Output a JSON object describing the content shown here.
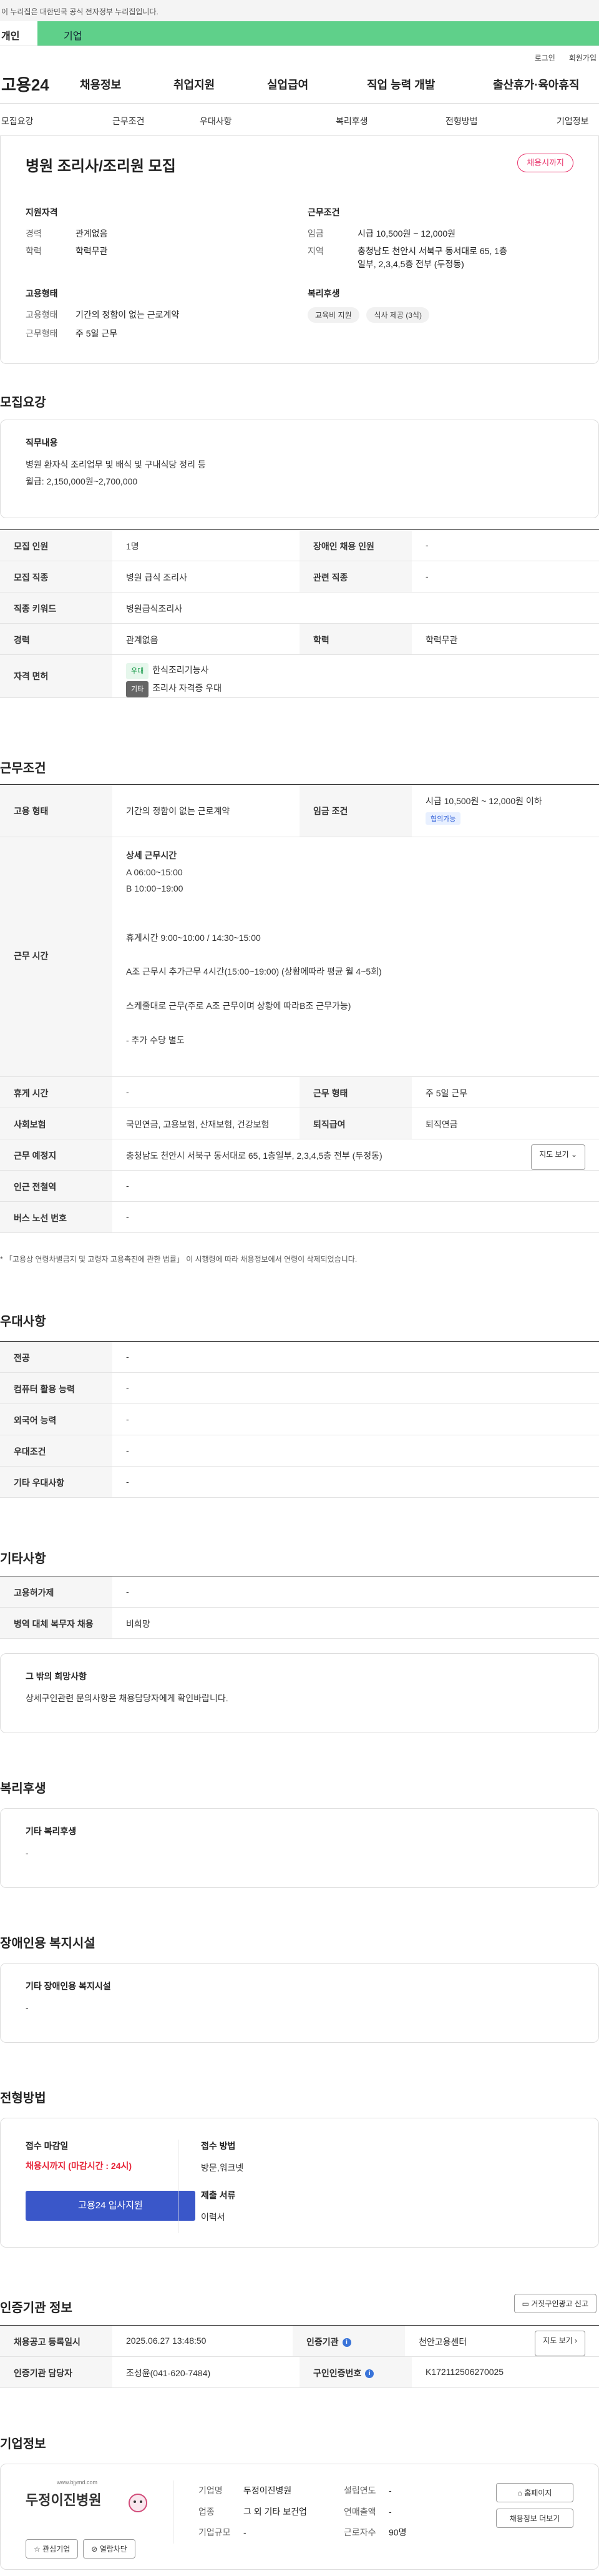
{
  "gov_banner": "이 누리집은 대한민국 공식 전자정부 누리집입니다.",
  "usertabs": {
    "personal": "개인",
    "corporate": "기업"
  },
  "util": {
    "login": "로그인",
    "signup": "회원가입"
  },
  "gnb": {
    "logo": "고용24",
    "items": [
      "채용정보",
      "취업지원",
      "실업급여",
      "직업 능력 개발",
      "출산휴가·육아휴직"
    ]
  },
  "subnav": [
    "모집요강",
    "근무조건",
    "우대사항",
    "복리후생",
    "전형방법",
    "기업정보"
  ],
  "summary": {
    "title": "병원 조리사/조리원 모집",
    "status_badge": "채용시까지",
    "qual_title": "지원자격",
    "career_label": "경력",
    "career_value": "관계없음",
    "edu_label": "학력",
    "edu_value": "학력무관",
    "cond_title": "근무조건",
    "wage_label": "임금",
    "wage_value": "시급 10,500원 ~ 12,000원",
    "loc_label": "지역",
    "loc_value": "충청남도 천안시 서북구 동서대로 65, 1층일부, 2,3,4,5층 전부 (두정동)",
    "emp_title": "고용형태",
    "emptype_label": "고용형태",
    "emptype_value": "기간의 정함이 없는 근로계약",
    "workform_label": "근무형태",
    "workform_value": "주 5일 근무",
    "welfare_title": "복리후생",
    "welfare_tags": [
      "교육비 지원",
      "식사 제공 (3식)"
    ]
  },
  "recruit": {
    "section_title": "모집요강",
    "duty_title": "직무내용",
    "duty_text": "병원 환자식 조리업무 및 배식 및 구내식당 정리 등",
    "duty_wage": "월급: 2,150,000원~2,700,000",
    "rows": [
      {
        "h1": "모집 인원",
        "v1": "1명",
        "h2": "장애인 채용 인원",
        "v2": "-"
      },
      {
        "h1": "모집 직종",
        "v1": "병원 급식 조리사",
        "h2": "관련 직종",
        "v2": "-"
      },
      {
        "h1": "직종 키워드",
        "v1": "병원급식조리사"
      },
      {
        "h1": "경력",
        "v1": "관계없음",
        "h2": "학력",
        "v2": "학력무관"
      }
    ],
    "license_label": "자격 면허",
    "license_tag1": "우대",
    "license_name1": "한식조리기능사",
    "license_tag2": "기타",
    "license_name2": "조리사 자격증 우대"
  },
  "conditions": {
    "section_title": "근무조건",
    "emptype_label": "고용 형태",
    "emptype_value": "기간의 정함이 없는 근로계약",
    "wage_label": "임금 조건",
    "wage_value": "시급 10,500원 ~ 12,000원 이하",
    "wage_tag": "협의가능",
    "hours_label": "근무 시간",
    "hours_lines": [
      "상세 근무시간",
      "A  06:00~15:00",
      "B  10:00~19:00",
      "",
      "휴게시간 9:00~10:00 / 14:30~15:00",
      "",
      "A조 근무시 추가근무 4시간(15:00~19:00) (상황에따라 평균 월 4~5회)",
      "",
      "스케줄대로 근무(주로 A조 근무이며 상황에 따라B조 근무가능)",
      "",
      "- 추가 수당 별도"
    ],
    "break_label": "휴게 시간",
    "break_value": "-",
    "workform_label": "근무 형태",
    "workform_value": "주 5일 근무",
    "insurance_label": "사회보험",
    "insurance_value": "국민연금, 고용보험, 산재보험, 건강보험",
    "severance_label": "퇴직급여",
    "severance_value": "퇴직연금",
    "place_label": "근무 예정지",
    "place_value": "충청남도 천안시 서북구 동서대로 65, 1층일부, 2,3,4,5층 전부 (두정동)",
    "map_btn": "지도 보기",
    "subway_label": "인근 전철역",
    "subway_value": "-",
    "bus_label": "버스 노선 번호",
    "bus_value": "-",
    "note": "* 「고용상 연령차별금지 및 고령자 고용촉진에 관한 법률」 이 시행령에 따라 채용정보에서 연령이 삭제되었습니다."
  },
  "pref": {
    "section_title": "우대사항",
    "rows": [
      {
        "h": "전공",
        "v": "-"
      },
      {
        "h": "컴퓨터 활용 능력",
        "v": "-"
      },
      {
        "h": "외국어 능력",
        "v": "-"
      },
      {
        "h": "우대조건",
        "v": "-"
      },
      {
        "h": "기타 우대사항",
        "v": "-"
      }
    ]
  },
  "etc": {
    "section_title": "기타사항",
    "rows": [
      {
        "h": "고용허가제",
        "v": "-"
      },
      {
        "h": "병역 대체 복무자 채용",
        "v": "비희망"
      }
    ],
    "box_title": "그 밖의 희망사항",
    "box_text": "상세구인관련 문의사항은 채용담당자에게 확인바랍니다."
  },
  "welfare": {
    "section_title": "복리후생",
    "box_title": "기타 복리후생",
    "box_text": "-"
  },
  "disabled": {
    "section_title": "장애인용 복지시설",
    "box_title": "기타 장애인용 복지시설",
    "box_text": "-"
  },
  "process": {
    "section_title": "전형방법",
    "deadline_label": "접수 마감일",
    "deadline_value": "채용시까지 (마감시간 : 24시)",
    "apply_button": "고용24 입사지원",
    "method_label": "접수 방법",
    "method_value": "방문,워크넷",
    "docs_label": "제출 서류",
    "docs_value": "이력서"
  },
  "agency": {
    "section_title": "인증기관 정보",
    "contact_btn": "거짓구인광고 신고",
    "rows": [
      {
        "h1": "채용공고 등록일시",
        "v1": "2025.06.27 13:48:50",
        "h2": "인증기관",
        "v2": "천안고용센터",
        "btn": "지도 보기"
      },
      {
        "h1": "인증기관 담당자",
        "v1": "조성윤(041-620-7484)",
        "h2": "구인인증번호",
        "v2": "K172112506270025"
      }
    ]
  },
  "company": {
    "section_title": "기업정보",
    "logo_url_text": "www.bjymd.com",
    "logo_name": "두정이진병원",
    "interest_btn": "관심기업",
    "block_btn": "열람차단",
    "fields": [
      {
        "k": "기업명",
        "v": "두정이진병원"
      },
      {
        "k": "업종",
        "v": "그 외 기타 보건업"
      },
      {
        "k": "기업규모",
        "v": "-"
      }
    ],
    "fields2": [
      {
        "k": "설립연도",
        "v": "-"
      },
      {
        "k": "연매출액",
        "v": "-"
      },
      {
        "k": "근로자수",
        "v": "90명"
      }
    ],
    "homepage_btn": "홈페이지",
    "info_btn": "채용정보 더보기"
  }
}
